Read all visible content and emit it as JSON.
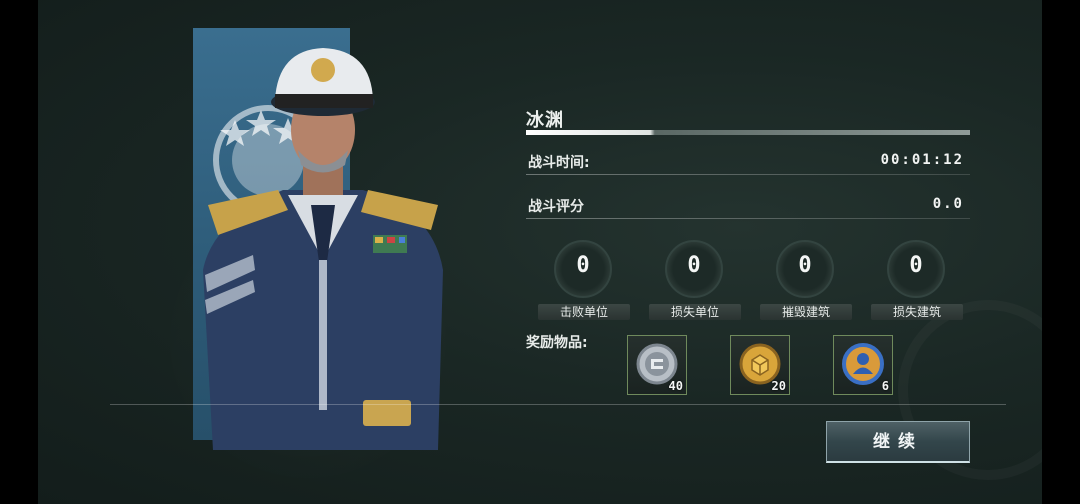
{
  "stage": {
    "title": "冰渊"
  },
  "battle_time": {
    "label": "战斗时间:",
    "value": "00:01:12"
  },
  "battle_score": {
    "label": "战斗评分",
    "value": "0.0"
  },
  "stats": [
    {
      "value": "0",
      "label": "击败单位"
    },
    {
      "value": "0",
      "label": "损失单位"
    },
    {
      "value": "0",
      "label": "摧毁建筑"
    },
    {
      "value": "0",
      "label": "损失建筑"
    }
  ],
  "rewards": {
    "label": "奖励物品:",
    "items": [
      {
        "icon": "silver-coin-icon",
        "qty": "40"
      },
      {
        "icon": "gold-crate-coin-icon",
        "qty": "20"
      },
      {
        "icon": "commander-badge-icon",
        "qty": "6"
      }
    ]
  },
  "continue_button": {
    "label": "继续"
  },
  "colors": {
    "banner": "#2d5b78",
    "reward_border": "#6f8a5c",
    "background": "#1a2724"
  }
}
